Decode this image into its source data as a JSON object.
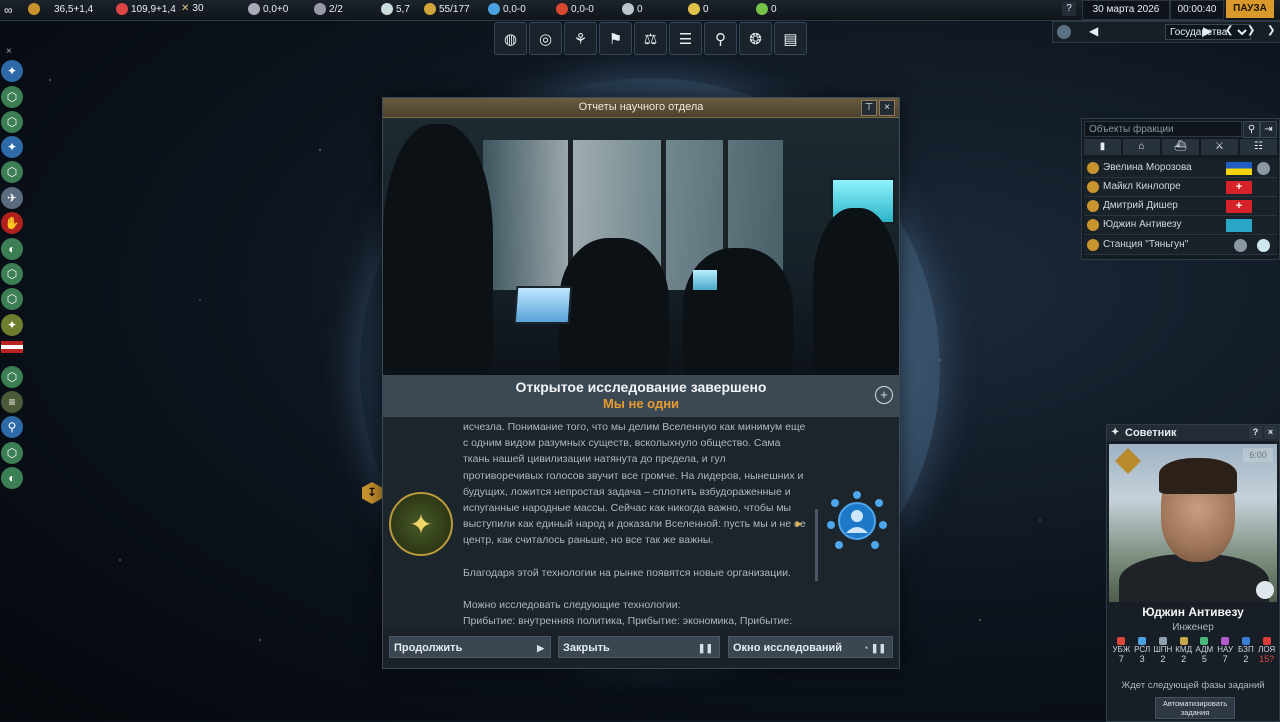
{
  "topbar": {
    "resources": [
      {
        "icon": "influence-icon",
        "value": "36,5+1,4"
      },
      {
        "icon": "ops-icon",
        "value": "109,9+1,4"
      },
      {
        "icon": "military-icon",
        "value": "30"
      },
      {
        "icon": "boost-icon",
        "value": "0,0+0"
      },
      {
        "icon": "mission-control-icon",
        "value": "2/2"
      },
      {
        "icon": "research-icon",
        "value": "5,7"
      },
      {
        "icon": "cp-icon",
        "value": "55/177"
      },
      {
        "icon": "water-icon",
        "value": "0,0-0"
      },
      {
        "icon": "volatiles-icon",
        "value": "0,0-0"
      },
      {
        "icon": "metals-icon",
        "value": "0"
      },
      {
        "icon": "noble-metals-icon",
        "value": "0"
      },
      {
        "icon": "fissiles-icon",
        "value": "0"
      }
    ],
    "help": "?",
    "date": "30 марта 2026",
    "time": "00:00:40",
    "pause": "ПАУЗА"
  },
  "time_controls": {
    "view_selected": "Государства"
  },
  "toolbar": {
    "icons": [
      "globe-icon",
      "solar-system-icon",
      "hierarchy-icon",
      "flag-icon",
      "finance-icon",
      "sliders-icon",
      "research-icon",
      "brain-icon",
      "ledger-icon"
    ]
  },
  "sidebar": {
    "close": "×",
    "icons": [
      "councilor-icon",
      "councilor-icon",
      "councilor-icon",
      "councilor-icon",
      "councilor-icon",
      "eagle-icon",
      "red-hand-icon",
      "globe-icon",
      "councilor-icon",
      "councilor-icon",
      "compass-icon",
      "us-flag-icon",
      "councilor-icon",
      "badge-icon",
      "research-icon",
      "councilor-icon",
      "globe-icon"
    ]
  },
  "dialog": {
    "title": "Отчеты научного отдела",
    "pin_label": "⊤",
    "close_label": "×",
    "heading": "Открытое исследование завершено",
    "subheading": "Мы не одни",
    "body_paragraphs": [
      "исчезла. Понимание того, что мы делим Вселенную как минимум еще с одним видом разумных существ, всколыхнуло общество. Сама ткань нашей цивилизации натянута до предела, и гул противоречивых голосов звучит все громче. На лидеров, нынешних и будущих, ложится непростая задача – сплотить взбудораженные и испуганные народные массы. Сейчас как никогда важно, чтобы мы выступили как единый народ и доказали Вселенной: пусть мы и не ее центр, как считалось раньше, но все так же важны.",
      "Благодаря этой технологии на рынке появятся новые организации.",
      "Можно исследовать следующие технологии:\nПрибытие: внутренняя политика, Прибытие: экономика, Прибытие:"
    ],
    "buttons": {
      "continue": "Продолжить",
      "close": "Закрыть",
      "research_window": "Окно исследований"
    }
  },
  "faction_panel": {
    "search_placeholder": "Объекты фракции",
    "tabs": [
      "councilor-tab-icon",
      "hab-tab-icon",
      "fleet-tab-icon",
      "army-tab-icon",
      "settings-tab-icon"
    ],
    "rows": [
      {
        "name": "Эвелина Морозова",
        "flag": "ua"
      },
      {
        "name": "Майкл Кинлопре",
        "flag": "ch"
      },
      {
        "name": "Дмитрий Дишер",
        "flag": "ch"
      },
      {
        "name": "Юджин Антивезу",
        "flag": "kz"
      },
      {
        "name": "Станция \"Тяньгун\"",
        "flag": ""
      }
    ]
  },
  "advisor": {
    "title": "Советник",
    "help": "?",
    "close": "×",
    "score": "6:00",
    "name": "Юджин Антивезу",
    "role": "Инженер",
    "stats": [
      {
        "label": "УБЖ",
        "value": "7"
      },
      {
        "label": "РСЛ",
        "value": "3"
      },
      {
        "label": "ШПН",
        "value": "2"
      },
      {
        "label": "КМД",
        "value": "2"
      },
      {
        "label": "АДМ",
        "value": "5"
      },
      {
        "label": "НАУ",
        "value": "7"
      },
      {
        "label": "БЗП",
        "value": "2"
      },
      {
        "label": "ЛОЯ",
        "value": "15?"
      }
    ],
    "status": "Ждет следующей фазы заданий",
    "auto_button": "Автоматизировать задания"
  }
}
